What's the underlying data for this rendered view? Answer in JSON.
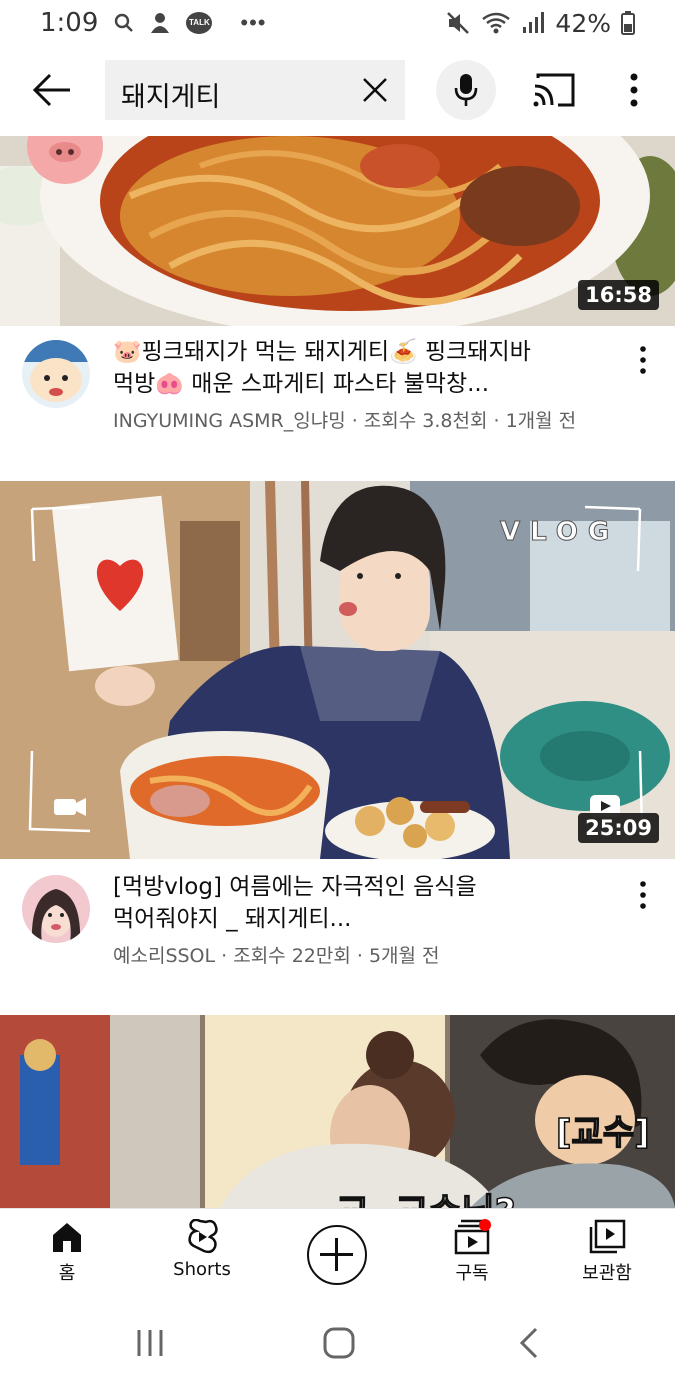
{
  "status_bar": {
    "time": "1:09",
    "notification_icons": [
      "search-icon",
      "profile-icon",
      "talk-icon",
      "more-dots-icon"
    ],
    "right_icons": [
      "mute-icon",
      "wifi-icon",
      "signal-icon"
    ],
    "battery_percent": "42%",
    "talk_badge": "TALK"
  },
  "header": {
    "search_query": "돼지게티"
  },
  "videos": [
    {
      "duration": "16:58",
      "title": "🐷핑크돼지가 먹는 돼지게티🍝 핑크돼지바 먹방🐽 매운 스파게티 파스타 불막창...",
      "title_line1": "🐷핑크돼지가 먹는 돼지게티🍝 핑크돼지바",
      "title_line2": "먹방🐽 매운 스파게티 파스타 불막창...",
      "channel": "INGYUMING ASMR_잉냐밍",
      "views": "조회수 3.8천회",
      "age": "1개월 전",
      "sub_line": "INGYUMING ASMR_잉냐밍 · 조회수 3.8천회 · 1개월 전"
    },
    {
      "duration": "25:09",
      "thumb_overlay": "VLOG",
      "title_line1": "[먹방vlog] 여름에는 자극적인 음식을",
      "title_line2": "먹어줘야지 _ 돼지게티...",
      "channel": "예소리SSOL",
      "views": "조회수 22만회",
      "age": "5개월 전",
      "sub_line": "예소리SSOL · 조회수 22만회 · 5개월 전"
    },
    {
      "thumb_caption_right": "[교수]",
      "thumb_caption_bottom": "교, 교수님?"
    }
  ],
  "bottom_nav": {
    "home": "홈",
    "shorts": "Shorts",
    "subscriptions": "구독",
    "library": "보관함"
  },
  "colors": {
    "accent_red": "#ff0000",
    "text_primary": "#0f0f0f",
    "text_secondary": "#606060"
  }
}
